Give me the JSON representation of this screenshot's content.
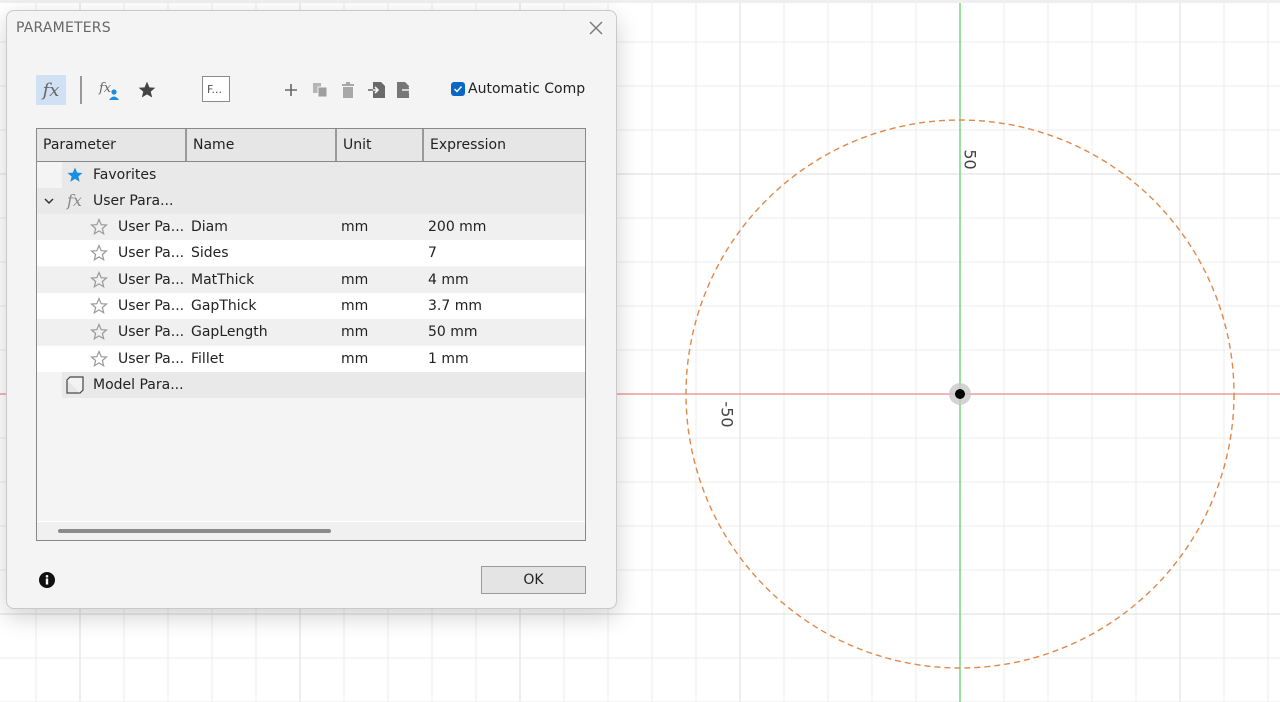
{
  "dialog": {
    "title": "PARAMETERS",
    "close_icon": "close-icon",
    "toolbar": {
      "all_params_icon": "fx-icon",
      "user_params_icon": "fx-user-icon",
      "favorites_icon": "star-icon",
      "filter_value": "F...",
      "add_icon": "plus-icon",
      "copy_icon": "copy-icon",
      "delete_icon": "trash-icon",
      "import_icon": "import-icon",
      "export_icon": "export-icon",
      "auto_compute_label": "Automatic Comp",
      "auto_compute_checked": true
    },
    "table": {
      "columns": [
        "Parameter",
        "Name",
        "Unit",
        "Expression"
      ],
      "groups": {
        "favorites": "Favorites",
        "user": "User Para...",
        "model": "Model Para..."
      },
      "rows": [
        {
          "parameter": "User Pa...",
          "name": "Diam",
          "unit": "mm",
          "expression": "200 mm"
        },
        {
          "parameter": "User Pa...",
          "name": "Sides",
          "unit": "",
          "expression": "7"
        },
        {
          "parameter": "User Pa...",
          "name": "MatThick",
          "unit": "mm",
          "expression": "4 mm"
        },
        {
          "parameter": "User Pa...",
          "name": "GapThick",
          "unit": "mm",
          "expression": "3.7 mm"
        },
        {
          "parameter": "User Pa...",
          "name": "GapLength",
          "unit": "mm",
          "expression": "50 mm"
        },
        {
          "parameter": "User Pa...",
          "name": "Fillet",
          "unit": "mm",
          "expression": "1 mm"
        }
      ]
    },
    "ok_label": "OK",
    "info_icon": "info-icon"
  },
  "canvas": {
    "dim_label_top": "50",
    "dim_label_left": "-50",
    "circle_diameter_mm": 100,
    "colors": {
      "x_axis": "#e88a8a",
      "y_axis": "#7ad67a",
      "circle": "#e0894a",
      "accent": "#0a68c4",
      "favorite_star": "#1a8fe0"
    }
  }
}
